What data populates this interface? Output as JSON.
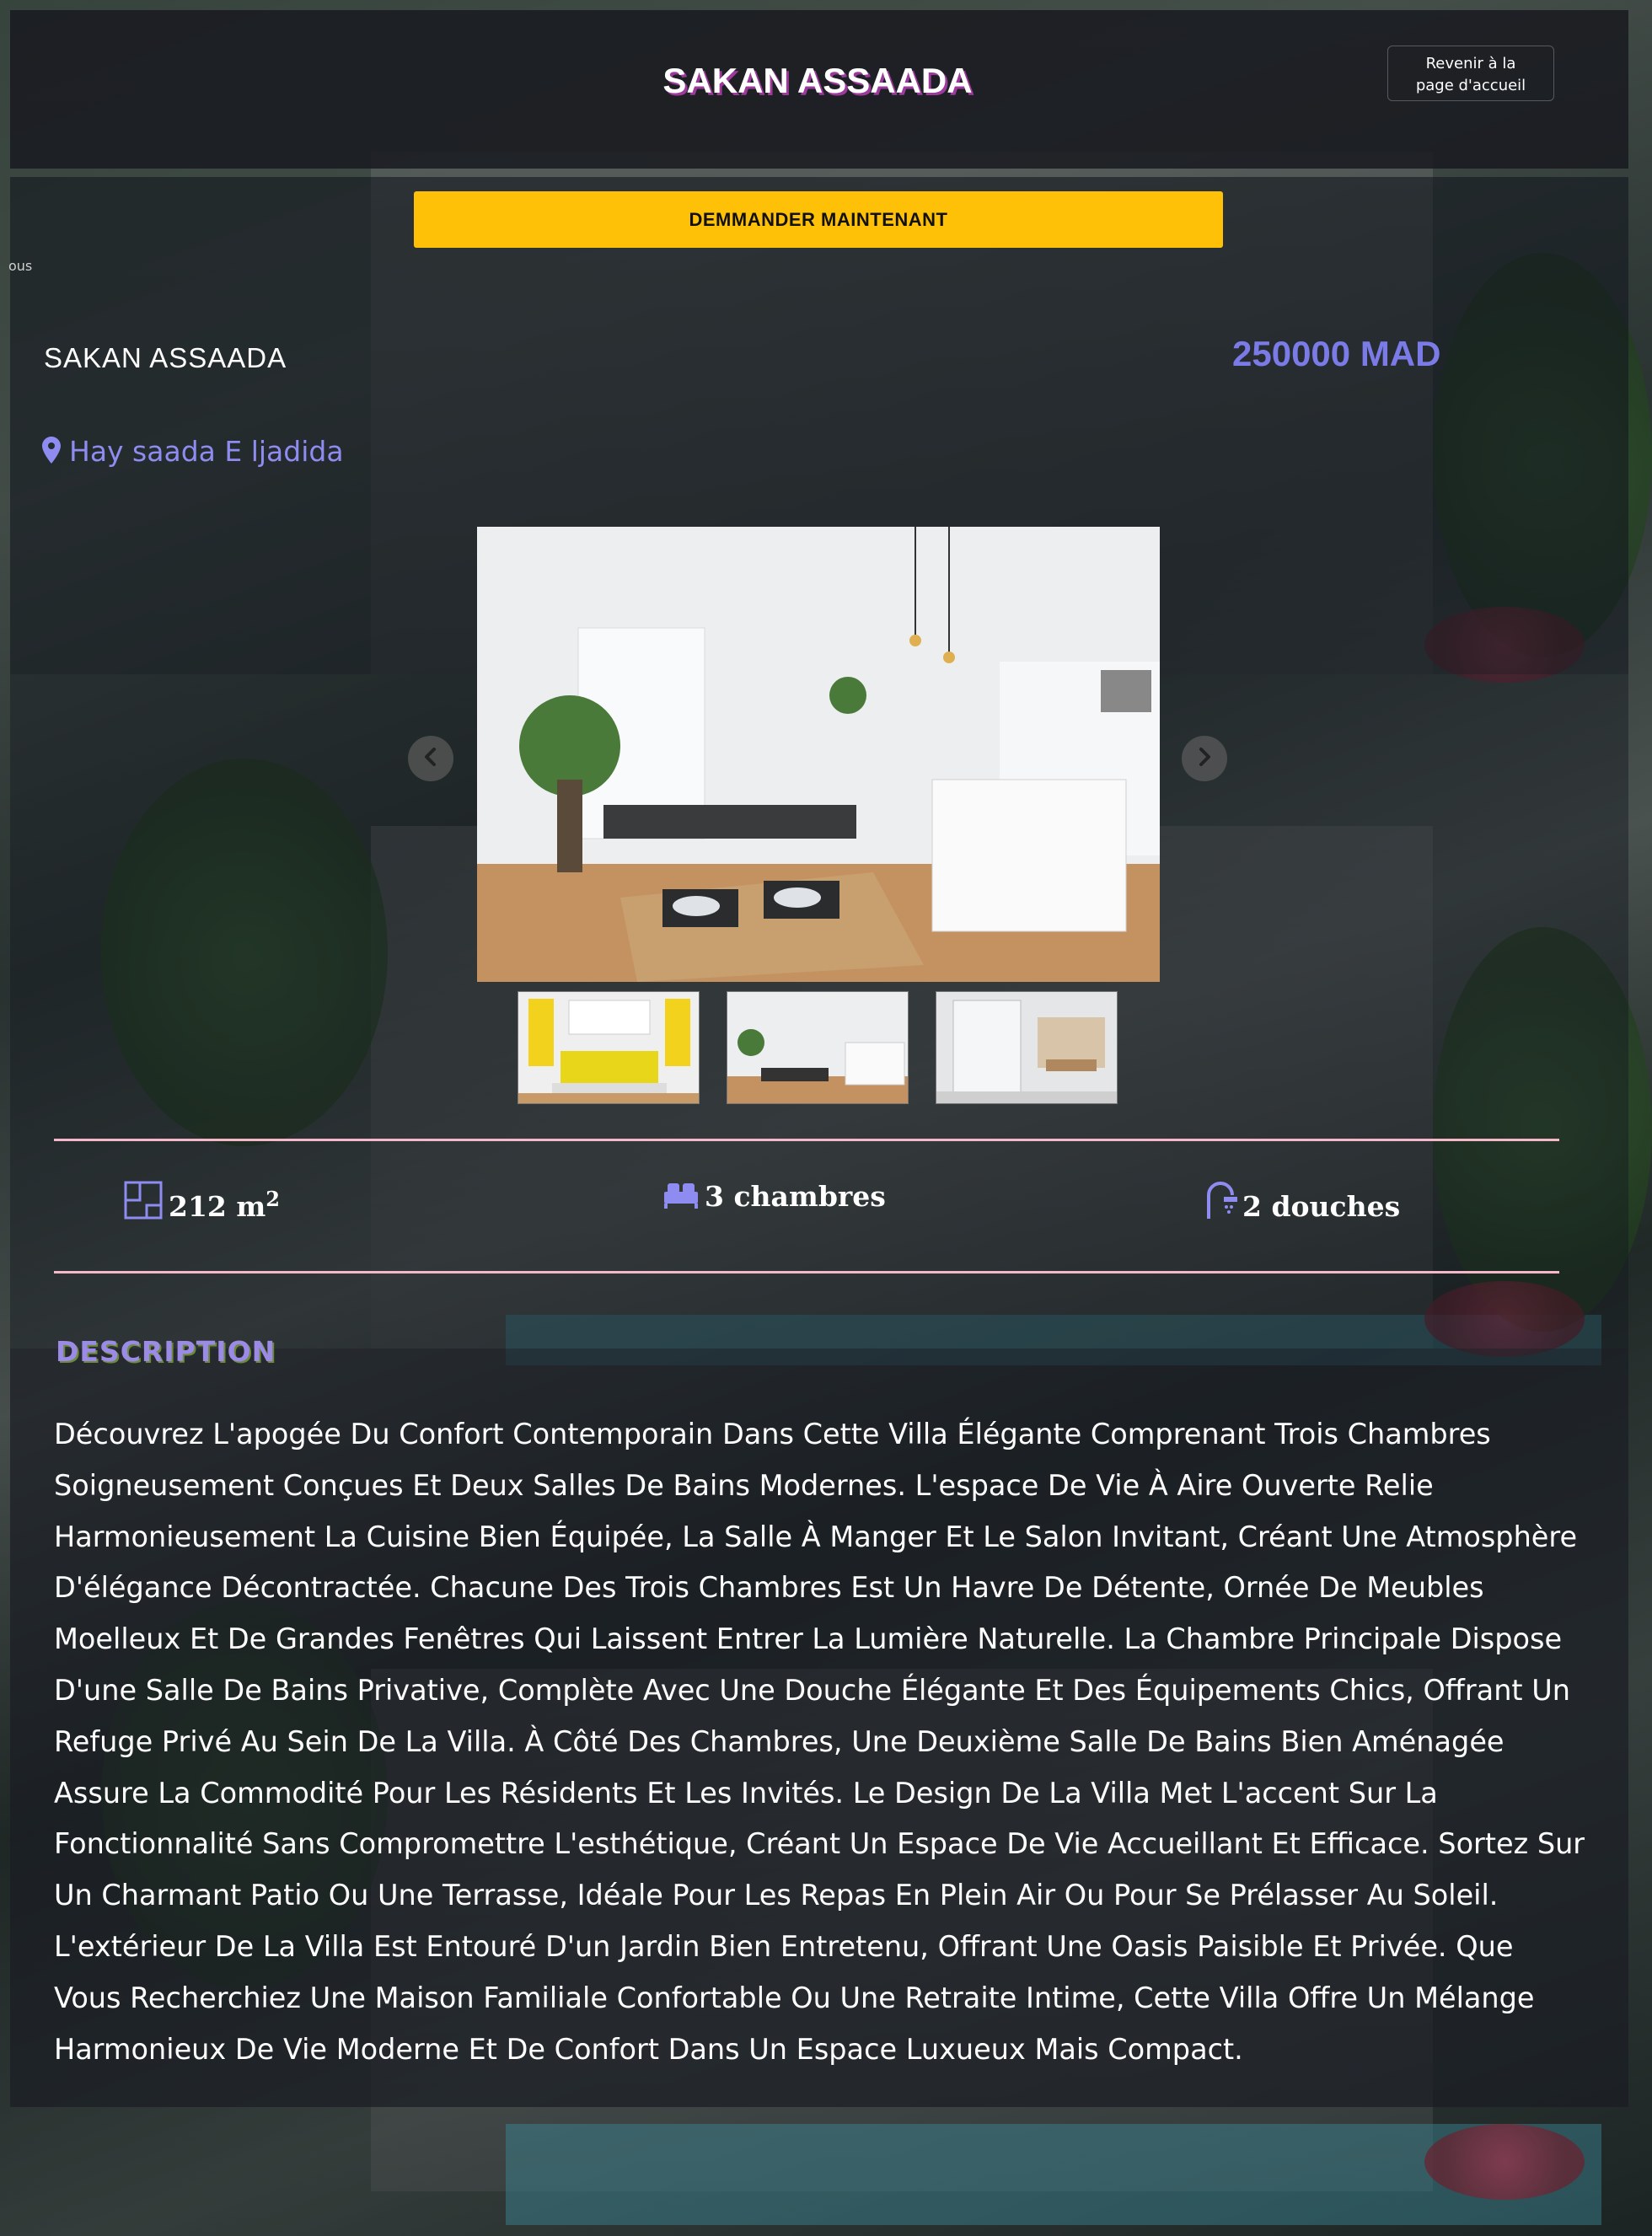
{
  "header": {
    "brand": "SAKAN ASSAADA",
    "home_button_label": "Revenir à la page d'accueil"
  },
  "cta": {
    "label": "DEMMANDER MAINTENANT"
  },
  "stray_text": "ous",
  "property": {
    "name": "SAKAN ASSAADA",
    "price": "250000 MAD",
    "location": "Hay saada E ljadida"
  },
  "gallery": {
    "thumbnails": [
      "bedroom-yellow",
      "kitchen-dining",
      "bathroom-shower"
    ]
  },
  "features": {
    "area": "212 m",
    "area_unit_sup": "2",
    "rooms": "3 chambres",
    "showers": "2 douches"
  },
  "description": {
    "title": "DESCRIPTION",
    "body": "Découvrez L'apogée Du Confort Contemporain Dans Cette Villa Élégante Comprenant Trois Chambres Soigneusement Conçues Et Deux Salles De Bains Modernes. L'espace De Vie À Aire Ouverte Relie Harmonieusement La Cuisine Bien Équipée, La Salle À Manger Et Le Salon Invitant, Créant Une Atmosphère D'élégance Décontractée. Chacune Des Trois Chambres Est Un Havre De Détente, Ornée De Meubles Moelleux Et De Grandes Fenêtres Qui Laissent Entrer La Lumière Naturelle. La Chambre Principale Dispose D'une Salle De Bains Privative, Complète Avec Une Douche Élégante Et Des Équipements Chics, Offrant Un Refuge Privé Au Sein De La Villa. À Côté Des Chambres, Une Deuxième Salle De Bains Bien Aménagée Assure La Commodité Pour Les Résidents Et Les Invités. Le Design De La Villa Met L'accent Sur La Fonctionnalité Sans Compromettre L'esthétique, Créant Un Espace De Vie Accueillant Et Efficace. Sortez Sur Un Charmant Patio Ou Une Terrasse, Idéale Pour Les Repas En Plein Air Ou Pour Se Prélasser Au Soleil. L'extérieur De La Villa Est Entouré D'un Jardin Bien Entretenu, Offrant Une Oasis Paisible Et Privée. Que Vous Recherchiez Une Maison Familiale Confortable Ou Une Retraite Intime, Cette Villa Offre Un Mélange Harmonieux De Vie Moderne Et De Confort Dans Un Espace Luxueux Mais Compact."
  },
  "colors": {
    "accent": "#7b7be8",
    "cta": "#ffc107",
    "divider": "#f4b8c8",
    "brand_shadow": "#9b3a9a"
  },
  "icons": {
    "location": "map-pin-icon",
    "area": "floor-plan-icon",
    "rooms": "bed-icon",
    "showers": "shower-icon",
    "prev": "chevron-left-icon",
    "next": "chevron-right-icon"
  }
}
